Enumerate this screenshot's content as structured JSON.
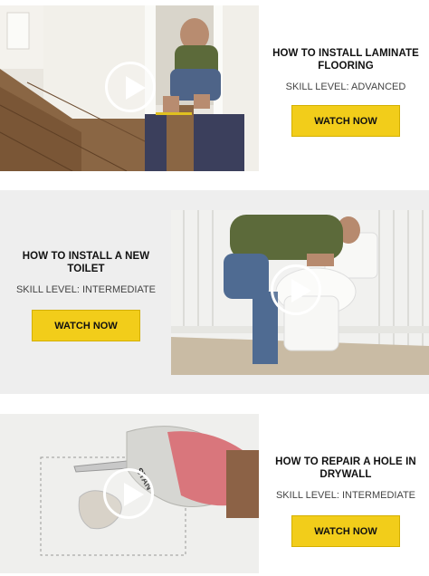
{
  "cards": [
    {
      "title_line1": "HOW TO INSTALL LAMINATE",
      "title_line2": "FLOORING",
      "skill": "SKILL LEVEL: ADVANCED",
      "button": "WATCH NOW",
      "image": "man-installing-laminate-floor"
    },
    {
      "title_line1": "HOW TO INSTALL A NEW",
      "title_line2": "TOILET",
      "skill": "SKILL LEVEL: INTERMEDIATE",
      "button": "WATCH NOW",
      "image": "man-lifting-toilet"
    },
    {
      "title_line1": "HOW TO REPAIR A HOLE IN",
      "title_line2": "DRYWALL",
      "skill": "SKILL LEVEL: INTERMEDIATE",
      "button": "WATCH NOW",
      "image": "gloved-hand-cutting-drywall"
    }
  ],
  "colors": {
    "button": "#f2cd1a",
    "row_alt_bg": "#eeeeee"
  },
  "icons": {
    "play": "play-icon"
  }
}
